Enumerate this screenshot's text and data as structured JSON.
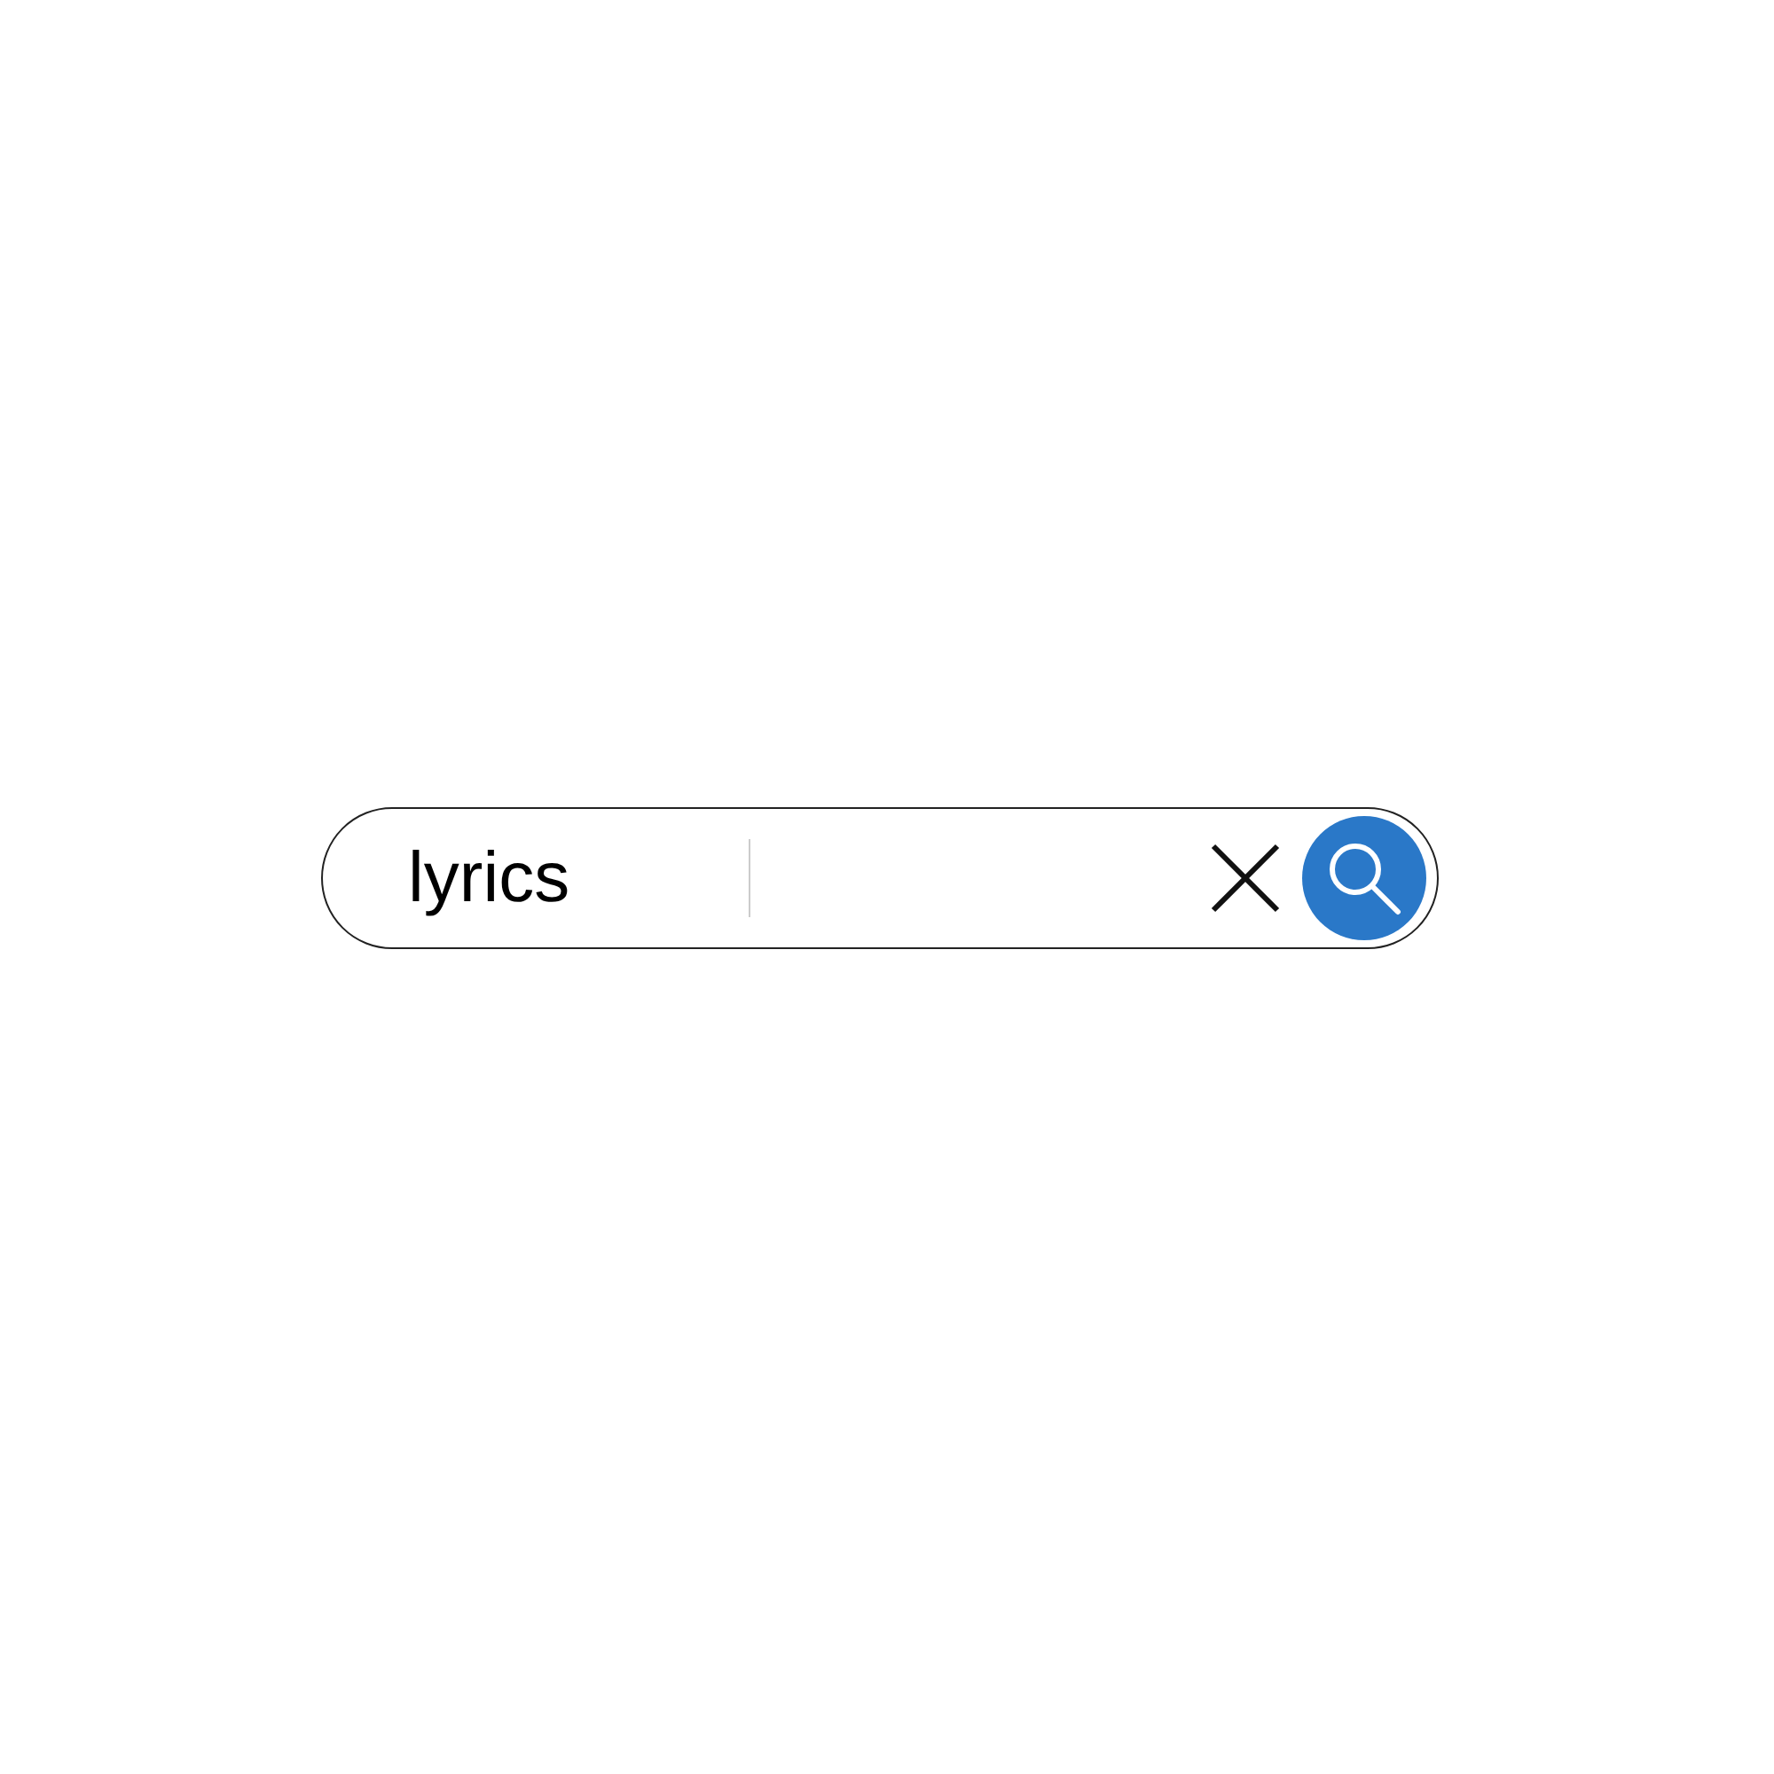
{
  "search": {
    "value": "lyrics"
  }
}
